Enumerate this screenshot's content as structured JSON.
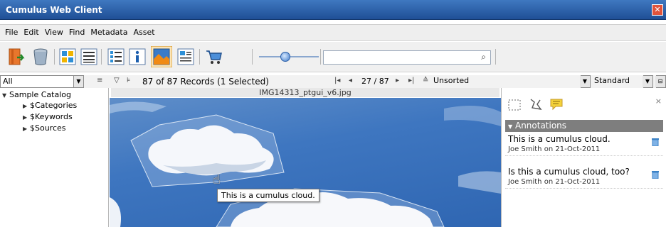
{
  "window": {
    "title": "Cumulus Web Client",
    "close_symbol": "✕"
  },
  "menu": [
    "File",
    "Edit",
    "View",
    "Find",
    "Metadata",
    "Asset"
  ],
  "toolbar": {
    "icons": [
      "catalog-exit-icon",
      "trash-icon",
      "thumbnail-view-icon",
      "list-view-icon",
      "details-view-icon",
      "info-icon",
      "preview-icon",
      "template-view-icon",
      "cart-icon"
    ],
    "search_placeholder": "",
    "search_icon": "⌕"
  },
  "subbar": {
    "collection_filter": "All",
    "records_text": "87 of 87 Records (1 Selected)",
    "position": "27 / 87",
    "sort": "Unsorted",
    "view_mode": "Standard",
    "nav_first": "|◂",
    "nav_prev": "◂",
    "nav_next": "▸",
    "nav_last": "▸|",
    "sort_icon": "≙"
  },
  "tree": {
    "root": "Sample Catalog",
    "children": [
      "$Categories",
      "$Keywords",
      "$Sources"
    ]
  },
  "preview": {
    "filename": "IMG14313_ptgui_v6.jpg",
    "tooltip": "This is a cumulus cloud."
  },
  "annotations_panel": {
    "header": "Annotations",
    "close": "×",
    "items": [
      {
        "text": "This is a cumulus cloud.",
        "meta": "Joe Smith on 21-Oct-2011"
      },
      {
        "text": "Is this a cumulus cloud, too?",
        "meta": "Joe Smith on 21-Oct-2011"
      }
    ]
  },
  "colors": {
    "title_bar": "#2b5ea8",
    "accent": "#3b82c6",
    "panel_header": "#7e7e7e"
  }
}
